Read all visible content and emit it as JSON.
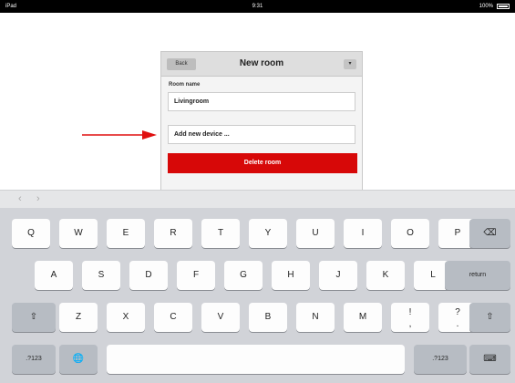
{
  "status_bar": {
    "carrier": "iPad",
    "time": "9:31",
    "battery_percent": "100%",
    "battery_level": 1.0
  },
  "modal": {
    "back_label": "Back",
    "title": "New room",
    "menu_label": "▾",
    "field_label": "Room name",
    "field_value": "Livingroom",
    "add_device_label": "Add new device ...",
    "delete_label": "Delete room"
  },
  "toolbar": {
    "prev_label": "‹",
    "next_label": "›"
  },
  "keyboard": {
    "row1": [
      "Q",
      "W",
      "E",
      "R",
      "T",
      "Y",
      "U",
      "I",
      "O",
      "P"
    ],
    "row2": [
      "A",
      "S",
      "D",
      "F",
      "G",
      "H",
      "J",
      "K",
      "L"
    ],
    "row3": [
      "Z",
      "X",
      "C",
      "V",
      "B",
      "N",
      "M"
    ],
    "excl": "!",
    "comma": ",",
    "question": "?",
    "period": ".",
    "return_label": "return",
    "numbers_label": ".?123",
    "backspace_icon": "⌫",
    "shift_icon": "⇧",
    "globe_icon": "🌐",
    "hide_icon": "⌨"
  },
  "colors": {
    "accent_red": "#d70808",
    "keyboard_bg": "#d1d3d8"
  }
}
